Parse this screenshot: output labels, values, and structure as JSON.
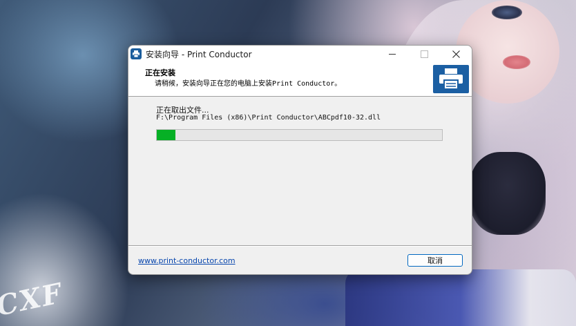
{
  "window": {
    "title": "安装向导 - Print Conductor"
  },
  "header": {
    "title": "正在安装",
    "subtitle": "请稍候，安装向导正在您的电脑上安装Print Conductor。"
  },
  "progress_section": {
    "status_label": "正在取出文件...",
    "file_path": "F:\\Program Files (x86)\\Print Conductor\\ABCpdf10-32.dll",
    "progress_fraction": 0.065
  },
  "footer": {
    "website_link": "www.print-conductor.com",
    "cancel_label": "取消"
  },
  "wallpaper": {
    "watermark": "CXF"
  },
  "icons": {
    "app": "printer-icon",
    "logo": "printer-logo-icon",
    "minimize": "minimize-icon",
    "maximize": "maximize-icon",
    "close": "close-icon"
  },
  "colors": {
    "progress_fill": "#06b025",
    "logo_blue": "#1b5fa3",
    "link": "#0645ad",
    "button_border": "#0067c0"
  }
}
